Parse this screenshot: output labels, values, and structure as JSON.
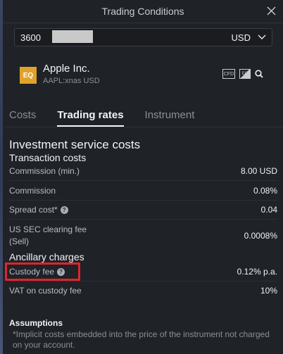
{
  "header": {
    "title": "Trading Conditions"
  },
  "account": {
    "number": "3600",
    "currency": "USD"
  },
  "instrument": {
    "badge": "EQ",
    "name": "Apple Inc.",
    "symbol": "AAPL:xnas USD",
    "icons": [
      "cfd-icon",
      "eq-chart-icon",
      "search-icon"
    ],
    "cfd_label": "CFD",
    "eq_label": "EQ"
  },
  "tabs": [
    {
      "label": "Costs"
    },
    {
      "label": "Trading rates"
    },
    {
      "label": "Instrument"
    }
  ],
  "section": {
    "title": "Investment service costs",
    "transaction_title": "Transaction costs",
    "ancillary_title": "Ancillary charges"
  },
  "rows": [
    {
      "label": "Commission (min.)",
      "value": "8.00 USD"
    },
    {
      "label": "Commission",
      "value": "0.08%"
    },
    {
      "label": "Spread cost*",
      "value": "0.04"
    },
    {
      "label_line1": "US SEC clearing fee",
      "label_line2": "(Sell)",
      "value": "0.0008%"
    },
    {
      "label": "Custody fee",
      "value": "0.12% p.a."
    },
    {
      "label": "VAT on custody fee",
      "value": "10%"
    }
  ],
  "assumptions": {
    "title": "Assumptions",
    "text": "*Implicit costs embedded into the price of the instrument not charged on your account."
  },
  "help_glyph": "?"
}
